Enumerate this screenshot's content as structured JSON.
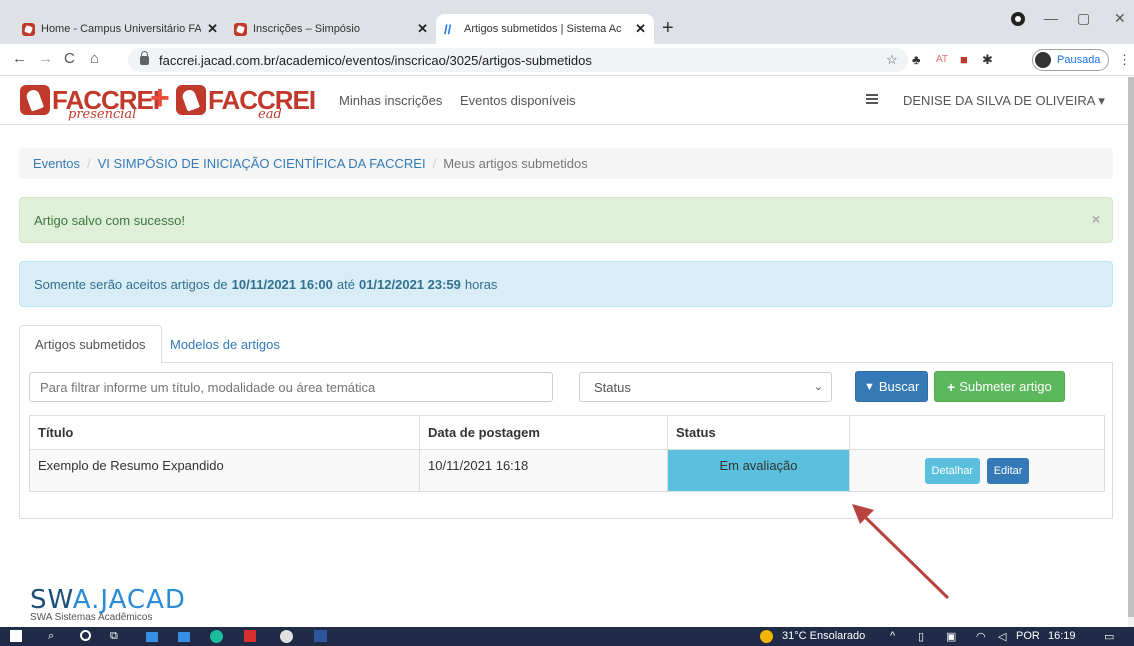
{
  "browser": {
    "tabs": [
      {
        "label": "Home - Campus Universitário FA",
        "close": "✕"
      },
      {
        "label": "Inscrições – Simpósio",
        "close": "✕"
      },
      {
        "label": "Artigos submetidos | Sistema Ac",
        "close": "✕"
      }
    ],
    "new_tab": "+",
    "url": "faccrei.jacad.com.br/academico/eventos/inscricao/3025/artigos-submetidos",
    "profile_status": "Pausada",
    "ext_at": "AT"
  },
  "nav": {
    "logo_left": "FACCREI",
    "logo_left_sub": "presencial",
    "logo_right": "FACCREI",
    "logo_right_sub": "ead",
    "links": [
      "Minhas inscrições",
      "Eventos disponíveis"
    ],
    "user": "DENISE DA SILVA DE OLIVEIRA ▾"
  },
  "breadcrumb": {
    "items": [
      "Eventos",
      "VI SIMPÓSIO DE INICIAÇÃO CIENTÍFICA DA FACCREI"
    ],
    "current": "Meus artigos submetidos",
    "separator": "/"
  },
  "alerts": {
    "success": "Artigo salvo com sucesso!",
    "info_prefix": "Somente serão aceitos artigos de",
    "info_start": "10/11/2021 16:00",
    "info_mid": "até",
    "info_end": "01/12/2021 23:59",
    "info_suffix": "horas"
  },
  "tabs": [
    "Artigos submetidos",
    "Modelos de artigos"
  ],
  "filter": {
    "placeholder": "Para filtrar informe um título, modalidade ou área temática",
    "status_selected": "Status",
    "search_button": "Buscar",
    "submit_button": "Submeter artigo"
  },
  "table": {
    "headers": [
      "Título",
      "Data de postagem",
      "Status",
      ""
    ],
    "rows": [
      {
        "title": "Exemplo de Resumo Expandido",
        "date": "10/11/2021 16:18",
        "status": "Em avaliação",
        "detail": "Detalhar",
        "edit": "Editar"
      }
    ]
  },
  "footer": {
    "brand_a": "SW",
    "brand_b": "A.JACAD",
    "tagline": "SWA Sistemas Acadêmicos"
  },
  "taskbar": {
    "weather": "31°C  Ensolarado",
    "lang": "POR",
    "time": "16:19"
  },
  "colors": {
    "brand_red": "#c0392b",
    "primary": "#337ab7",
    "success": "#5cb85c",
    "info": "#5bc0de",
    "annotation_arrow": "#b8433f"
  }
}
